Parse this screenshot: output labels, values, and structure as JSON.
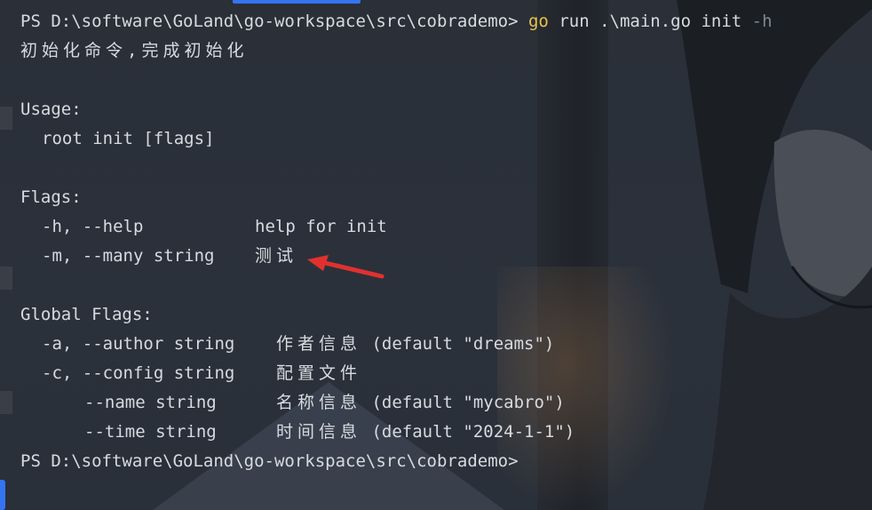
{
  "terminal": {
    "prompt": "PS D:\\software\\GoLand\\go-workspace\\src\\cobrademo>",
    "command_go": "go",
    "command_args": "run .\\main.go init",
    "command_flag": "-h",
    "description": "初始化命令,完成初始化",
    "usage_header": "Usage:",
    "usage_line": "root init [flags]",
    "flags_header": "Flags:",
    "flags": [
      {
        "name": "-h, --help",
        "desc": "help for init"
      },
      {
        "name": "-m, --many string",
        "desc": "测试"
      }
    ],
    "global_header": "Global Flags:",
    "global_flags": [
      {
        "name": "-a, --author string",
        "desc": "作者信息",
        "default": "(default \"dreams\")"
      },
      {
        "name": "-c, --config string",
        "desc": "配置文件",
        "default": ""
      },
      {
        "name": "--name string",
        "desc": "名称信息",
        "default": "(default \"mycabro\")"
      },
      {
        "name": "--time string",
        "desc": "时间信息",
        "default": "(default \"2024-1-1\")"
      }
    ],
    "final_prompt": "PS D:\\software\\GoLand\\go-workspace\\src\\cobrademo>"
  },
  "colors": {
    "text": "#d7dbe0",
    "command": "#e8c44a",
    "flag_dim": "#7e8691",
    "annotation_arrow": "#e0312f",
    "accent": "#3574f0"
  },
  "icons": {
    "annotation": "red-arrow-icon"
  }
}
